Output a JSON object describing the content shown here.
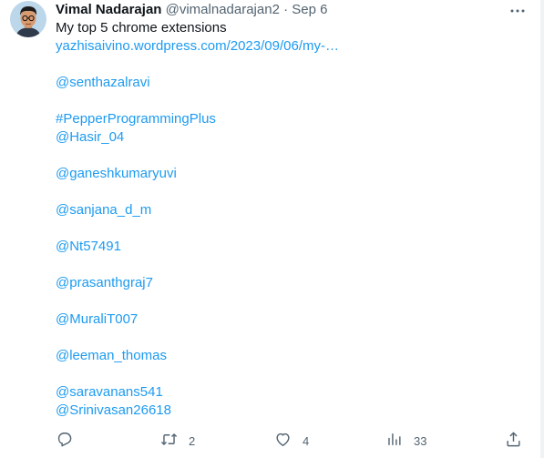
{
  "tweet": {
    "author_name": "Vimal Nadarajan",
    "author_handle": "@vimalnadarajan2",
    "separator": "·",
    "date": "Sep 6",
    "text": "My top 5 chrome extensions",
    "link": "yazhisaivino.wordpress.com/2023/09/06/my-…",
    "mentions": [
      "@senthazalravi",
      "",
      "#PepperProgrammingPlus",
      "@Hasir_04",
      "",
      "@ganeshkumaryuvi",
      "",
      "@sanjana_d_m",
      "",
      "@Nt57491",
      "",
      "@prasanthgraj7",
      "",
      "@MuraliT007",
      "",
      "@leeman_thomas",
      "",
      "@saravanans541",
      "@Srinivasan26618"
    ]
  },
  "actions": {
    "reply_count": "",
    "retweet_count": "2",
    "like_count": "4",
    "view_count": "33"
  },
  "icons": {
    "reply": "reply-icon",
    "retweet": "retweet-icon",
    "like": "heart-icon",
    "views": "views-icon",
    "share": "share-icon",
    "more": "more-icon"
  },
  "colors": {
    "link": "#1d9bf0",
    "text": "#0f1419",
    "muted": "#536471"
  }
}
